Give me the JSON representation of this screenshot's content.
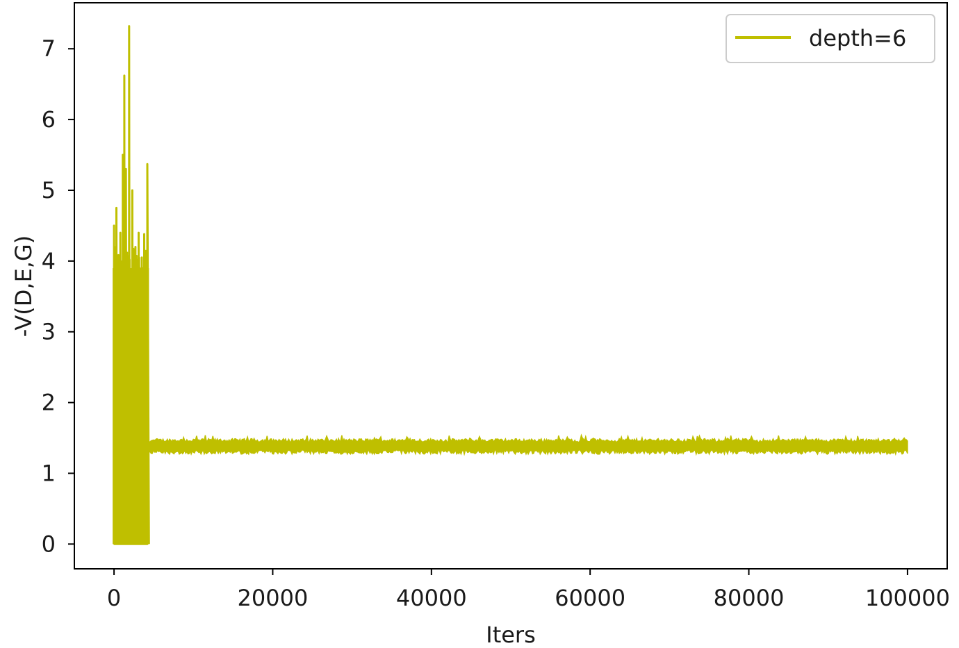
{
  "chart_data": {
    "type": "line",
    "xlabel": "Iters",
    "ylabel": "-V(D,E,G)",
    "xlim": [
      -5000,
      105000
    ],
    "ylim": [
      -0.35,
      7.65
    ],
    "xticks": [
      0,
      20000,
      40000,
      60000,
      80000,
      100000
    ],
    "xtick_labels": [
      "0",
      "20000",
      "40000",
      "60000",
      "80000",
      "100000"
    ],
    "yticks": [
      0,
      1,
      2,
      3,
      4,
      5,
      6,
      7
    ],
    "ytick_labels": [
      "0",
      "1",
      "2",
      "3",
      "4",
      "5",
      "6",
      "7"
    ],
    "grid": false,
    "legend_position": "upper right",
    "series": [
      {
        "name": "depth=6",
        "color": "#bfbf00",
        "early_phase": {
          "x_range": [
            0,
            4400
          ],
          "low": 0.0,
          "peaks": [
            {
              "x": 0,
              "y": 4.5
            },
            {
              "x": 300,
              "y": 4.75
            },
            {
              "x": 800,
              "y": 4.4
            },
            {
              "x": 1100,
              "y": 5.5
            },
            {
              "x": 1300,
              "y": 6.62
            },
            {
              "x": 1500,
              "y": 5.3
            },
            {
              "x": 1900,
              "y": 7.32
            },
            {
              "x": 2300,
              "y": 5.0
            },
            {
              "x": 2700,
              "y": 4.2
            },
            {
              "x": 3100,
              "y": 4.4
            },
            {
              "x": 3500,
              "y": 4.05
            },
            {
              "x": 3800,
              "y": 4.38
            },
            {
              "x": 4200,
              "y": 5.37
            }
          ]
        },
        "steady_phase": {
          "x_range": [
            4400,
            100000
          ],
          "mean": 1.38,
          "band": [
            1.27,
            1.5
          ]
        }
      }
    ]
  }
}
